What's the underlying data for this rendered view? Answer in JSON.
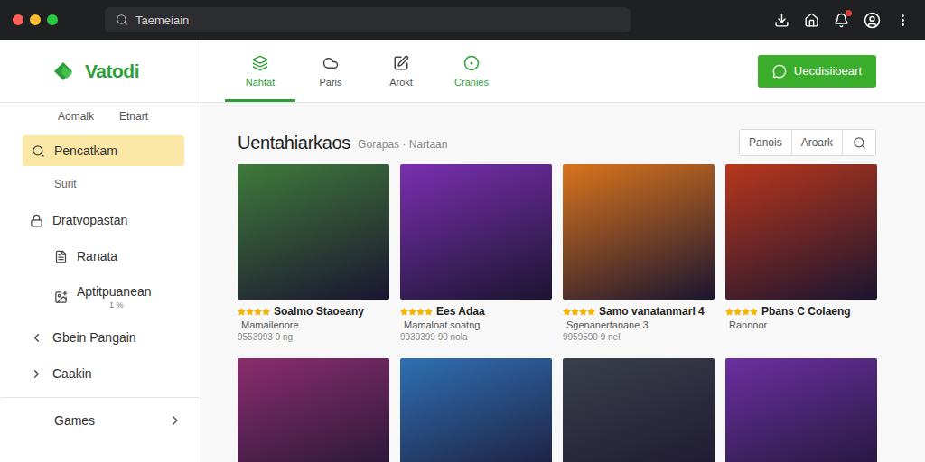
{
  "browser": {
    "address": "Taemeiain",
    "notifications_unread": true
  },
  "app": {
    "logo": "Vatodi"
  },
  "tabs": [
    {
      "label": "Nahtat",
      "selected": true
    },
    {
      "label": "Paris",
      "selected": false
    },
    {
      "label": "Arokt",
      "selected": false
    },
    {
      "label": "Cranies",
      "selected": false
    }
  ],
  "action_button": {
    "label": "Uecdisiioeart"
  },
  "sidebar": {
    "header": [
      "Aomalk",
      "Etnart"
    ],
    "items": [
      {
        "label": "Pencatkam",
        "kind": "search",
        "selected": true
      },
      {
        "label": "Surit",
        "kind": "sub",
        "selected": false
      },
      {
        "label": "Dratvopastan",
        "kind": "lock",
        "selected": false
      },
      {
        "label": "Ranata",
        "kind": "doc",
        "selected": false
      },
      {
        "label": "Aptitpuanean",
        "note": "1 %",
        "kind": "image",
        "selected": false
      },
      {
        "label": "Gbein Pangain",
        "kind": "collapse",
        "selected": false
      },
      {
        "label": "Caakin",
        "kind": "expand",
        "selected": false
      },
      {
        "label": "Games",
        "kind": "group",
        "selected": false
      }
    ]
  },
  "section": {
    "title": "Uentahiarkaos",
    "crumbs": "Gorapas · Nartaan",
    "filters": [
      {
        "label": "Panois",
        "selected": false
      },
      {
        "label": "Aroark",
        "selected": false
      }
    ]
  },
  "cards": [
    {
      "title": "Soalmo Staoeany",
      "subtitle": "Mamailenore",
      "meta": "9553993 9 ng",
      "stars": 4,
      "color": "#3f7a3a"
    },
    {
      "title": "Ees Adaa",
      "subtitle": "Mamaloat soatng",
      "meta": "9939399 90 nola",
      "stars": 4,
      "color": "#7a2fb0"
    },
    {
      "title": "Samo vanatanmarl 4",
      "subtitle": "Sgenanertanane 3",
      "meta": "9959590 9 nel",
      "stars": 4,
      "color": "#d9741c"
    },
    {
      "title": "Pbans C Colaeng",
      "subtitle": "Rannoor",
      "stars": 4,
      "color": "#b8361c"
    },
    {
      "color": "#8a2d6e"
    },
    {
      "color": "#2f6fb3"
    },
    {
      "color": "#3a3f4a"
    },
    {
      "color": "#6b2fa0"
    }
  ]
}
